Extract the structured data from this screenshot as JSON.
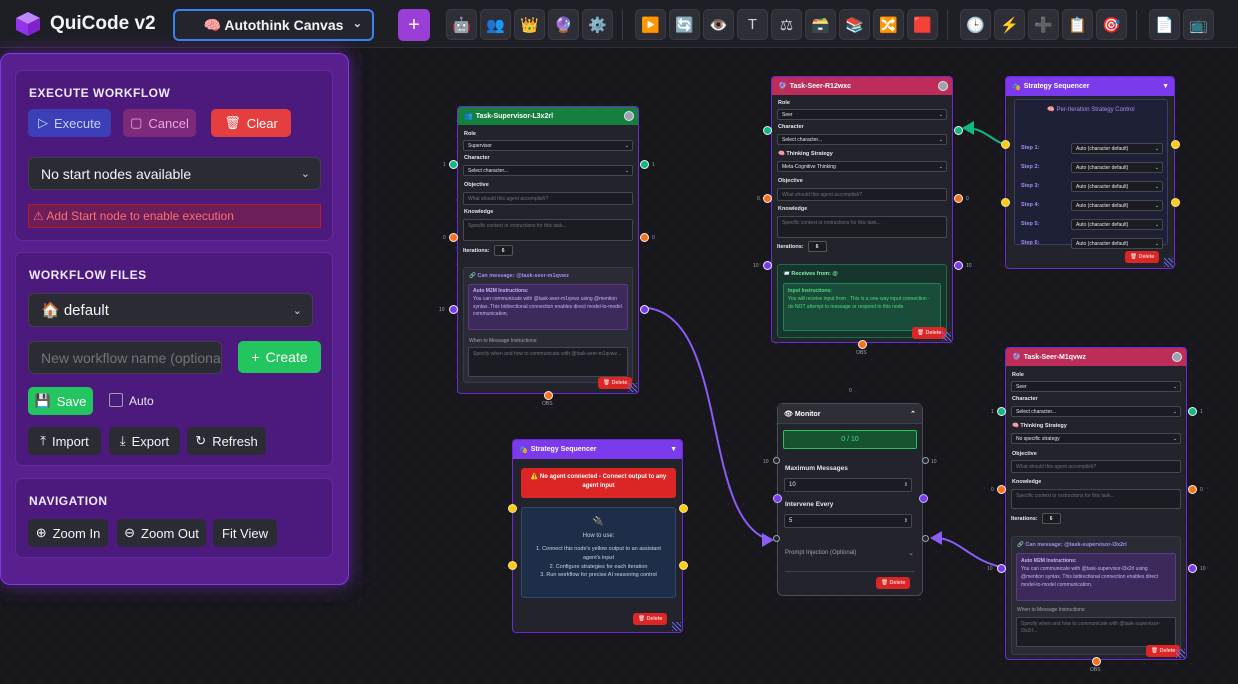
{
  "app": {
    "title": "QuiCode v2",
    "canvas_select": "🧠 Autothink Canvas",
    "add_label": "+"
  },
  "toolbar": {
    "group1": [
      "🤖",
      "👥",
      "👑",
      "🔮",
      "⚙️"
    ],
    "group2": [
      "▶️",
      "🔄",
      "👁️",
      "T",
      "⚖",
      "🗃️",
      "📚",
      "🔀",
      "🟥"
    ],
    "group3": [
      "🕒",
      "⚡",
      "➕",
      "📋",
      "🎯"
    ],
    "group4": [
      "📄",
      "📺"
    ]
  },
  "sidebar": {
    "execute": {
      "title": "EXECUTE WORKFLOW",
      "execute": "Execute",
      "cancel": "Cancel",
      "clear": "Clear",
      "start_select": "No start nodes available",
      "warning": "⚠ Add Start node to enable execution"
    },
    "files": {
      "title": "WORKFLOW FILES",
      "file_select": "🏠 default",
      "name_placeholder": "New workflow name (optional)",
      "create": "Create",
      "save": "Save",
      "auto": "Auto",
      "import": "Import",
      "export": "Export",
      "refresh": "Refresh"
    },
    "navigation": {
      "title": "NAVIGATION",
      "zoom_in": "Zoom In",
      "zoom_out": "Zoom Out",
      "fit_view": "Fit View"
    }
  },
  "nodes": {
    "supervisor": {
      "title": "Task-Supervisor-L3x2rl",
      "role_label": "Role",
      "role": "Supervisor",
      "character_label": "Character",
      "character": "Select character...",
      "objective_label": "Objective",
      "objective_ph": "What should this agent accomplish?",
      "knowledge_label": "Knowledge",
      "knowledge_ph": "Specific context or instructions for this task...",
      "iterations_label": "Iterations:",
      "iterations": "6",
      "can_message": "🔗 Can message: @task-seer-m1qvwz",
      "m2m_title": "Auto M2M Instructions:",
      "m2m_text": "You can communicate with @task-seer-m1qvwz using @mention syntax. This bidirectional connection enables direct model-to-model communication.",
      "when_label": "When to Message Instructions:",
      "when_ph": "Specify when and how to communicate with @task-seer-m1qvwz...",
      "delete": "🗑 Delete",
      "obs": "OBS",
      "port_left_top": "1",
      "port_right_top": "1",
      "port_left_mid": "0",
      "port_right_mid": "0",
      "port_left_low": "10"
    },
    "seer_r": {
      "title": "Task-Seer-R12wxc",
      "role_label": "Role",
      "role": "Seer",
      "character_label": "Character",
      "character": "Select character...",
      "thinking_label": "🧠 Thinking Strategy",
      "thinking": "Meta-Cognitive Thinking",
      "objective_label": "Objective",
      "objective_ph": "What should this agent accomplish?",
      "knowledge_label": "Knowledge",
      "knowledge_ph": "Specific context or instructions for this task...",
      "iterations_label": "Iterations:",
      "iterations": "6",
      "receives": "📨 Receives from: @",
      "input_title": "Input Instructions:",
      "input_text": "You will receive input from . This is a one-way input connection - do NOT attempt to message or respond to this node.",
      "delete": "🗑 Delete",
      "obs": "OBS",
      "port_left_mid": "0",
      "port_right_mid": "0",
      "port_left_low": "10",
      "port_right_low": "10"
    },
    "strategy_top": {
      "title": "Strategy Sequencer",
      "heading": "🧠 Per-Iteration Strategy Control",
      "steps": [
        {
          "label": "Step 1:",
          "value": "Auto (character default)"
        },
        {
          "label": "Step 2:",
          "value": "Auto (character default)"
        },
        {
          "label": "Step 3:",
          "value": "Auto (character default)"
        },
        {
          "label": "Step 4:",
          "value": "Auto (character default)"
        },
        {
          "label": "Step 5:",
          "value": "Auto (character default)"
        },
        {
          "label": "Step 6:",
          "value": "Auto (character default)"
        }
      ],
      "delete": "🗑 Delete"
    },
    "strategy_bottom": {
      "title": "Strategy Sequencer",
      "alert": "⚠️ No agent connected - Connect output to any agent input",
      "plug": "🔌",
      "howto_title": "How to use:",
      "howto": [
        "1. Connect this node's yellow output to an assistant agent's input",
        "2. Configure strategies for each iteration",
        "3. Run workflow for precise AI reasoning control"
      ],
      "delete": "🗑 Delete"
    },
    "monitor": {
      "title": "👁 Monitor",
      "counter": "0 / 10",
      "max_label": "Maximum Messages",
      "max": "10",
      "intervene_label": "Intervene Every",
      "intervene": "5",
      "prompt_label": "Prompt Injection (Optional)",
      "delete": "🗑 Delete",
      "port_top": "0",
      "port_left": "10",
      "port_right": "10"
    },
    "seer_m": {
      "title": "Task-Seer-M1qvwz",
      "role_label": "Role",
      "role": "Seer",
      "character_label": "Character",
      "character": "Select character...",
      "thinking_label": "🧠 Thinking Strategy",
      "thinking": "No specific strategy",
      "objective_label": "Objective",
      "objective_ph": "What should this agent accomplish?",
      "knowledge_label": "Knowledge",
      "knowledge_ph": "Specific context or instructions for this task...",
      "iterations_label": "Iterations:",
      "iterations": "6",
      "can_message": "🔗 Can message: @task-supervisor-l3x2rl",
      "m2m_title": "Auto M2M Instructions:",
      "m2m_text": "You can communicate with @task-supervisor-l3x2rl using @mention syntax. This bidirectional connection enables direct model-to-model communication.",
      "when_label": "When to Message Instructions:",
      "when_ph": "Specify when and how to communicate with @task-supervisor-l3x2rl...",
      "delete": "🗑 Delete",
      "obs": "OBS",
      "port_left_top": "1",
      "port_right_top": "1",
      "port_left_mid": "0",
      "port_right_mid": "0",
      "port_left_low": "10",
      "port_right_low": "10"
    }
  },
  "colors": {
    "accent_purple": "#9b3ed6",
    "supervisor_header": "#15803d",
    "seer_header": "#be2d5a",
    "strategy_header": "#7c3aed",
    "delete": "#dc2626",
    "execute": "#3b3fb8",
    "create": "#22c55e"
  }
}
